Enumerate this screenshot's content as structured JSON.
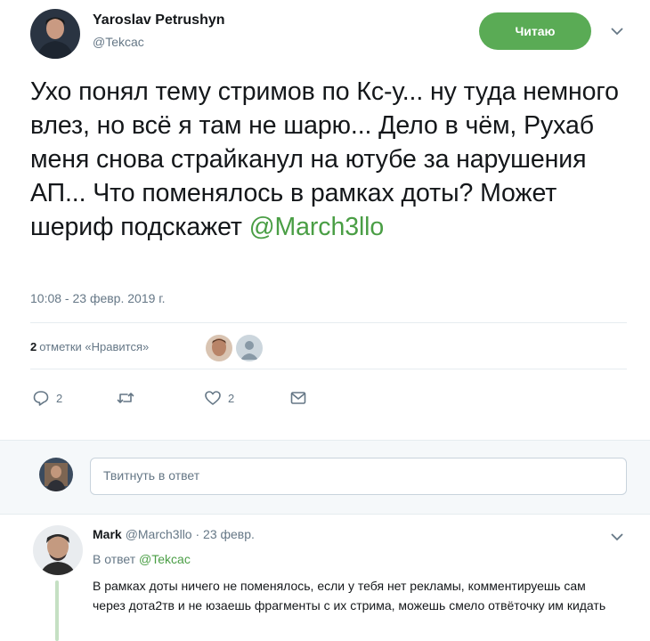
{
  "tweet": {
    "author_name": "Yaroslav Petrushyn",
    "author_handle": "@Tekcac",
    "follow_label": "Читаю",
    "text_main": "Ухо понял тему стримов по Кс-у... ну туда немного влез, но всё я там не шарю... Дело в чём, Рухаб меня снова страйканул на ютубе за нарушения АП... Что поменялось в рамках доты? Может шериф подскажет ",
    "mention": "@March3llo",
    "timestamp": "10:08 - 23 февр. 2019 г.",
    "likes_count": "2",
    "likes_label": "отметки «Нравится»",
    "actions": {
      "replies": "2",
      "retweets": "",
      "likes": "2"
    },
    "icons": {
      "reply": "reply-icon",
      "retweet": "retweet-icon",
      "like": "heart-icon",
      "dm": "envelope-icon",
      "more": "chevron-down-icon"
    }
  },
  "compose": {
    "placeholder": "Твитнуть в ответ"
  },
  "reply": {
    "name": "Mark",
    "handle": "@March3llo",
    "date": "· 23 февр.",
    "reply_to_prefix": "В ответ ",
    "reply_to_handle": "@Tekcac",
    "text": "В рамках доты ничего не поменялось, если у тебя нет рекламы, комментируешь сам через дота2тв и не юзаешь фрагменты с их стрима, можешь смело отвёточку им кидать"
  },
  "colors": {
    "accent_green": "#5aab55",
    "mention_green": "#4a9e45",
    "secondary_text": "#657786"
  }
}
